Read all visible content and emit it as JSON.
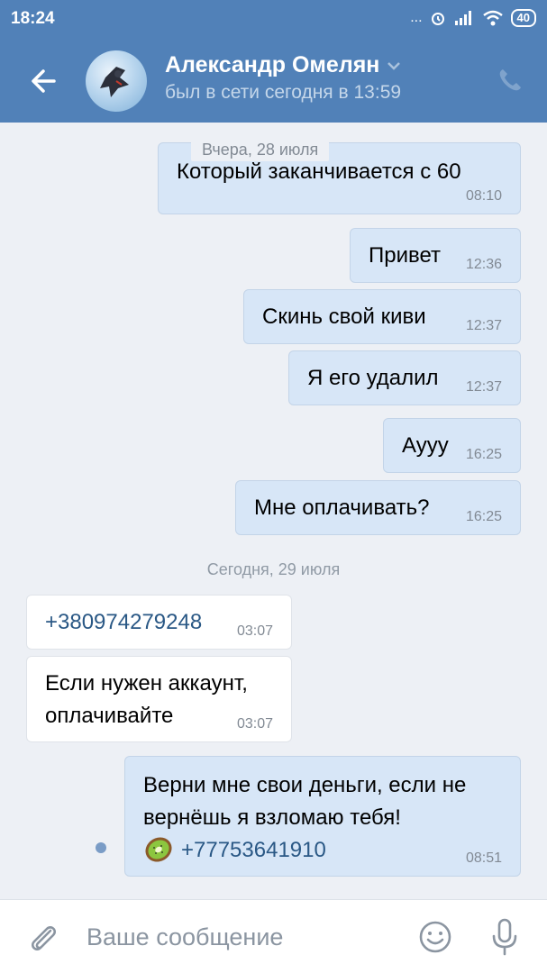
{
  "status_bar": {
    "time": "18:24",
    "signal_dots": "...",
    "battery": "40"
  },
  "header": {
    "contact_name": "Александр Омелян",
    "presence": "был в сети сегодня в 13:59"
  },
  "messages_group1": {
    "date_pill": "Вчера, 28 июля",
    "partial_text": "Который заканчивается с 60",
    "partial_time": "08:10",
    "m1_text": "Привет",
    "m1_time": "12:36",
    "m2_text": "Скинь свой киви",
    "m2_time": "12:37",
    "m3_text": "Я его удалил",
    "m3_time": "12:37",
    "m4_text": "Аууу",
    "m4_time": "16:25",
    "m5_text": "Мне оплачивать?",
    "m5_time": "16:25"
  },
  "messages_group2": {
    "date_separator": "Сегодня, 29 июля",
    "in1_phone": "+380974279248",
    "in1_time": "03:07",
    "in2_line1": "Если нужен аккаунт,",
    "in2_line2": "оплачивайте",
    "in2_time": "03:07",
    "out_line1": "Верни мне свои деньги, если не",
    "out_line2": "вернёшь я взломаю тебя!",
    "out_phone": "+77753641910",
    "out_emoji": "kiwi-emoji",
    "out_time": "08:51"
  },
  "composer": {
    "placeholder": "Ваше сообщение"
  },
  "colors": {
    "header_bg": "#5181b8",
    "chat_bg": "#edf0f5",
    "outgoing_bubble": "#d7e6f7",
    "incoming_bubble": "#ffffff",
    "link": "#2a5885"
  }
}
